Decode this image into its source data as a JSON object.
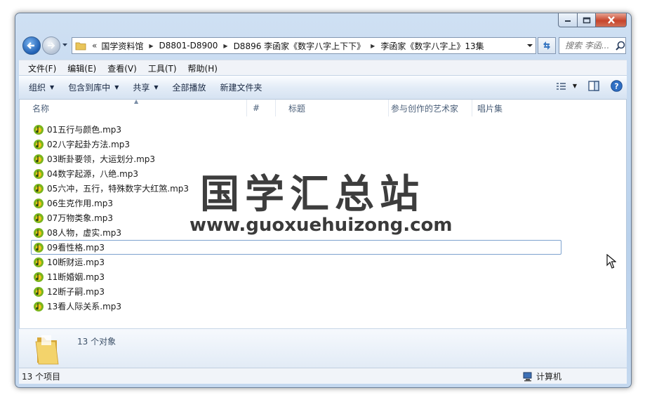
{
  "window": {
    "caption_buttons": [
      "minimize-icon",
      "maximize-icon",
      "close-icon"
    ]
  },
  "navigation": {
    "breadcrumbs": [
      "国学资料馆",
      "D8801-D8900",
      "D8896 李函家《数字八字上下下》",
      "李函家《数字八字上》13集"
    ],
    "overflow_glyph": "«",
    "search_placeholder": "搜索 李函..."
  },
  "menubar": {
    "items": [
      "文件(F)",
      "编辑(E)",
      "查看(V)",
      "工具(T)",
      "帮助(H)"
    ]
  },
  "toolbar": {
    "organize": "组织",
    "include_in_library": "包含到库中",
    "share": "共享",
    "play_all": "全部播放",
    "new_folder": "新建文件夹"
  },
  "columns": [
    "名称",
    "#",
    "标题",
    "参与创作的艺术家",
    "唱片集"
  ],
  "files": [
    "01五行与颜色.mp3",
    "02八字起卦方法.mp3",
    "03断卦要领，大运划分.mp3",
    "04数字起源，八绝.mp3",
    "05六冲，五行，特殊数字大红煞.mp3",
    "06生克作用.mp3",
    "07万物类象.mp3",
    "08人物，虚实.mp3",
    "09看性格.mp3",
    "10断财运.mp3",
    "11断婚姻.mp3",
    "12断子嗣.mp3",
    "13看人际关系.mp3"
  ],
  "focused_file_index": 8,
  "watermark": {
    "title": "国学汇总站",
    "url": "www.guoxuehuizong.com"
  },
  "details": {
    "object_count": "13 个对象"
  },
  "statusbar": {
    "items_count": "13 个项目",
    "location": "计算机"
  },
  "colors": {
    "window_frame": "#b9d1ec",
    "close_button": "#c7452c",
    "focus_border": "#7da2ce",
    "mp3_icon_green": "#7ab51d",
    "mp3_icon_yellow": "#f2c318"
  }
}
